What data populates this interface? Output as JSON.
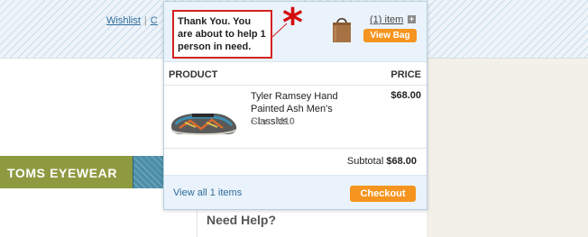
{
  "header": {
    "links": [
      "Wishlist",
      "|",
      "C"
    ]
  },
  "nav": {
    "eyewear_label": "TOMS EYEWEAR"
  },
  "help": {
    "heading": "Need Help?"
  },
  "cart": {
    "annotation_mark": "*",
    "thank_you_message": "Thank You. You are about to help 1 person in need.",
    "item_count_label": "(1) item",
    "plus_label": "+",
    "view_bag_label": "View Bag",
    "columns": {
      "product": "PRODUCT",
      "price": "PRICE"
    },
    "items": [
      {
        "name": "Tyler Ramsey Hand Painted Ash Men's Classics",
        "size_label": "Size:",
        "size_value": "M10",
        "price": "$68.00"
      }
    ],
    "subtotal_label": "Subtotal",
    "subtotal_value": "$68.00",
    "view_all_label": "View all 1 items",
    "checkout_label": "Checkout"
  },
  "colors": {
    "accent_orange": "#f5941e",
    "link_blue": "#2e6c99",
    "annotation_red": "#d42020",
    "eyewear_green": "#8e9a40"
  },
  "icons": [
    "shopping-bag-icon",
    "plus-icon",
    "annotation-asterisk-icon"
  ]
}
